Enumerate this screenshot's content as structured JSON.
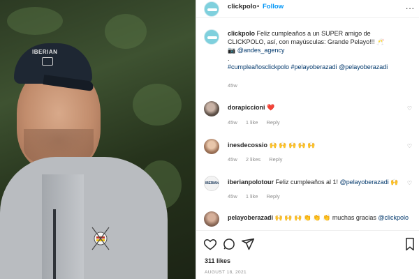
{
  "header": {
    "username": "clickpolo",
    "separator": "•",
    "follow_label": "Follow",
    "more_label": "..."
  },
  "caption": {
    "username": "clickpolo",
    "text": "Feliz cumpleaños a un SUPER amigo de CLICKPOLO, así, con mayúsculas: Grande Pelayo!!! 🥂",
    "camera_emoji": "📷",
    "agency": "@andes_agency",
    "dot": ".",
    "hashtags": "#cumpleañosclickpolo #pelayoberazadi @pelayoberazadi",
    "time": "45w"
  },
  "comments": [
    {
      "username": "dorapiccioni",
      "text": "",
      "emoji": "❤️",
      "time": "45w",
      "likes": "1 like",
      "reply": "Reply"
    },
    {
      "username": "inesdecossio",
      "text": "",
      "emoji": "🙌 🙌 🙌 🙌 🙌",
      "time": "45w",
      "likes": "2 likes",
      "reply": "Reply"
    },
    {
      "username": "iberianpolotour",
      "text": "Feliz cumpleaños al 1!",
      "mention": "@pelayoberazadi",
      "emoji": "🙌",
      "time": "45w",
      "likes": "1 like",
      "reply": "Reply",
      "avatar_text": "IBERIAN"
    },
    {
      "username": "pelayoberazadi",
      "text": "muchas gracias",
      "mention": "@clickpolo",
      "emoji": "🙌 🙌 🙌 👏 👏 👏",
      "time": "",
      "likes": "",
      "reply": ""
    }
  ],
  "photo": {
    "cap_text": "IBERIAN"
  },
  "actions": {
    "likes": "311 likes",
    "date": "AUGUST 18, 2021"
  },
  "icons": [
    "heart-icon",
    "comment-icon",
    "share-icon",
    "more-icon"
  ]
}
